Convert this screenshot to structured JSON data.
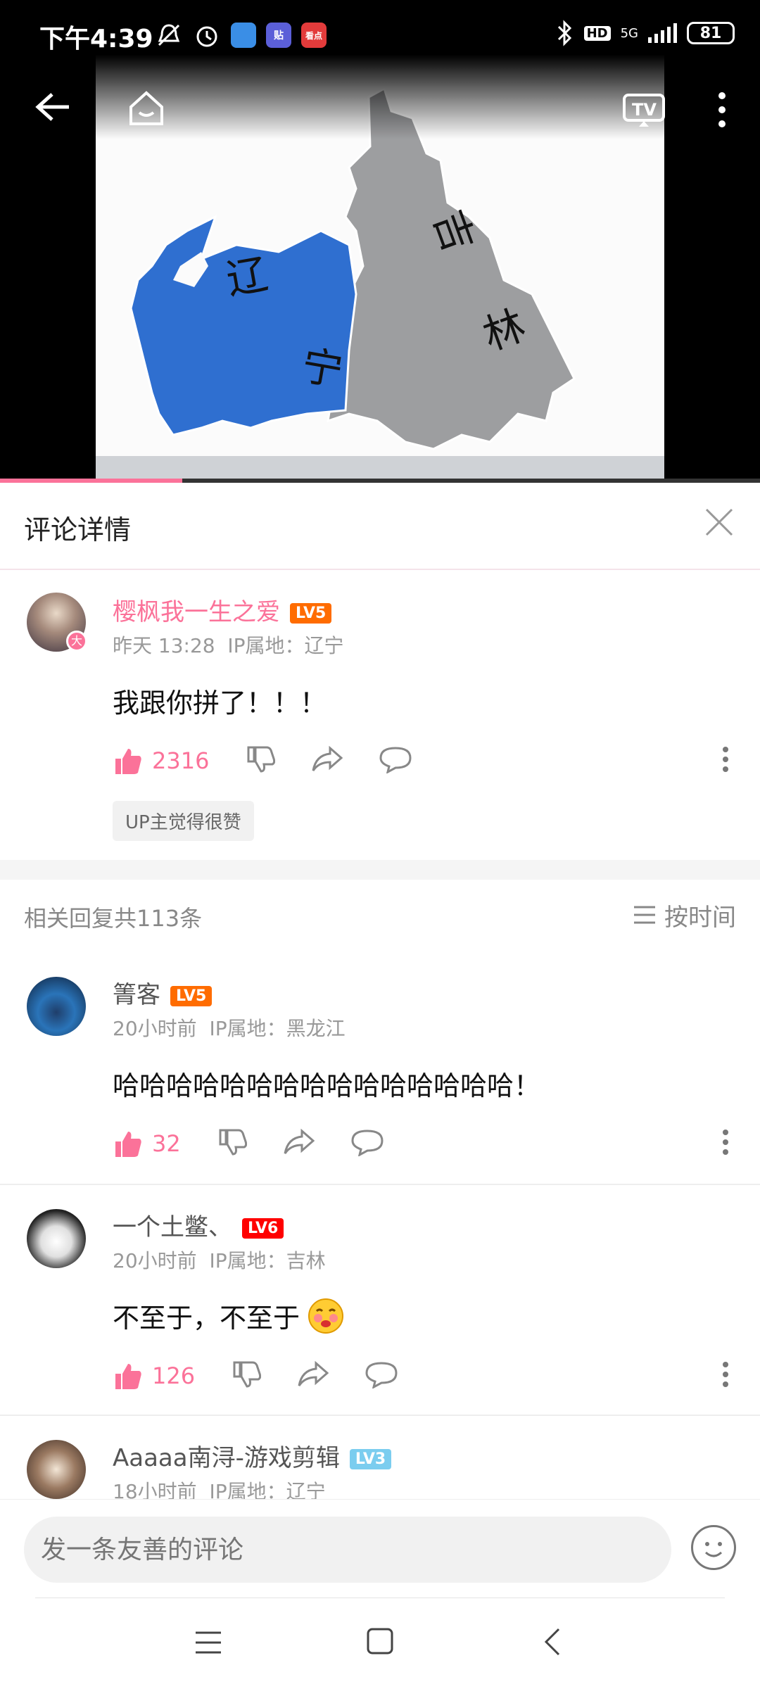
{
  "status_bar": {
    "time": "下午4:39",
    "app_badges": [
      {
        "label": "",
        "color": "#3a8ee6"
      },
      {
        "label": "贴",
        "color": "#5b5fd8"
      },
      {
        "label": "看点",
        "color": "#e33b3b"
      }
    ],
    "network": "5G",
    "hd": "HD",
    "battery": "81"
  },
  "video": {
    "map_labels": [
      "辽宁",
      "吉林"
    ],
    "progress_percent": 24
  },
  "header": {
    "title": "评论详情"
  },
  "main_comment": {
    "username": "樱枫我一生之爱",
    "level": "LV5",
    "time": "昨天 13:28",
    "ip": "IP属地：辽宁",
    "content": "我跟你拼了！！！",
    "likes": "2316",
    "up_badge": "UP主觉得很赞"
  },
  "replies_header": {
    "count_text": "相关回复共113条",
    "sort_label": "按时间"
  },
  "replies": [
    {
      "username": "箐客",
      "level": "LV5",
      "time": "20小时前",
      "ip": "IP属地：黑龙江",
      "content": "哈哈哈哈哈哈哈哈哈哈哈哈哈哈哈！",
      "likes": "32"
    },
    {
      "username": "一个土鳖、",
      "level": "LV6",
      "time": "20小时前",
      "ip": "IP属地：吉林",
      "content": "不至于，不至于",
      "likes": "126"
    },
    {
      "username": "Aaaaa南浔-游戏剪辑",
      "level": "LV3",
      "time": "18小时前",
      "ip": "IP属地：辽宁"
    }
  ],
  "input": {
    "placeholder": "发一条友善的评论"
  },
  "colors": {
    "accent": "#fb7299",
    "lv5": "#ff6c00",
    "lv6": "#ff0000",
    "lv3": "#7bcdef"
  }
}
